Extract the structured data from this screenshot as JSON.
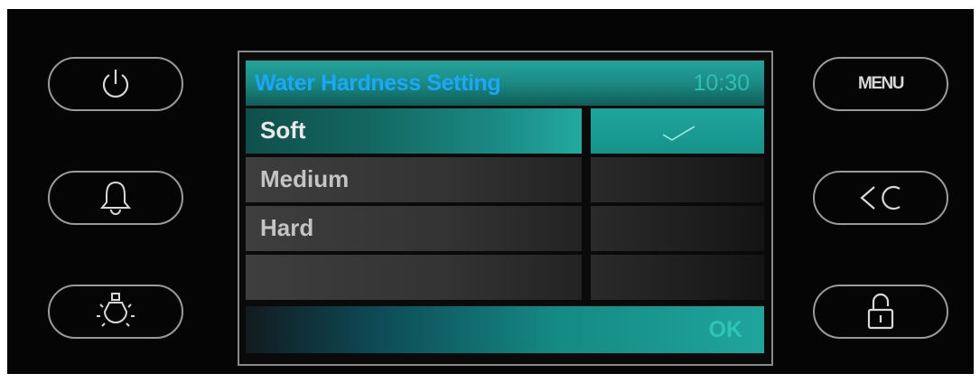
{
  "screen": {
    "title": "Water Hardness Setting",
    "time": "10:30",
    "options": [
      {
        "label": "Soft",
        "selected": true
      },
      {
        "label": "Medium",
        "selected": false
      },
      {
        "label": "Hard",
        "selected": false
      },
      {
        "label": "",
        "selected": false
      }
    ],
    "ok_label": "OK"
  },
  "left_buttons": [
    {
      "icon": "power-icon"
    },
    {
      "icon": "bell-icon"
    },
    {
      "icon": "light-bulb-icon"
    }
  ],
  "right_buttons": {
    "menu_label": "MENU",
    "back_icon": "back-clear-icon",
    "lock_icon": "unlock-icon"
  },
  "colors": {
    "accent": "#1fa59c",
    "title_text": "#1aa8ff",
    "panel": "#050505"
  }
}
